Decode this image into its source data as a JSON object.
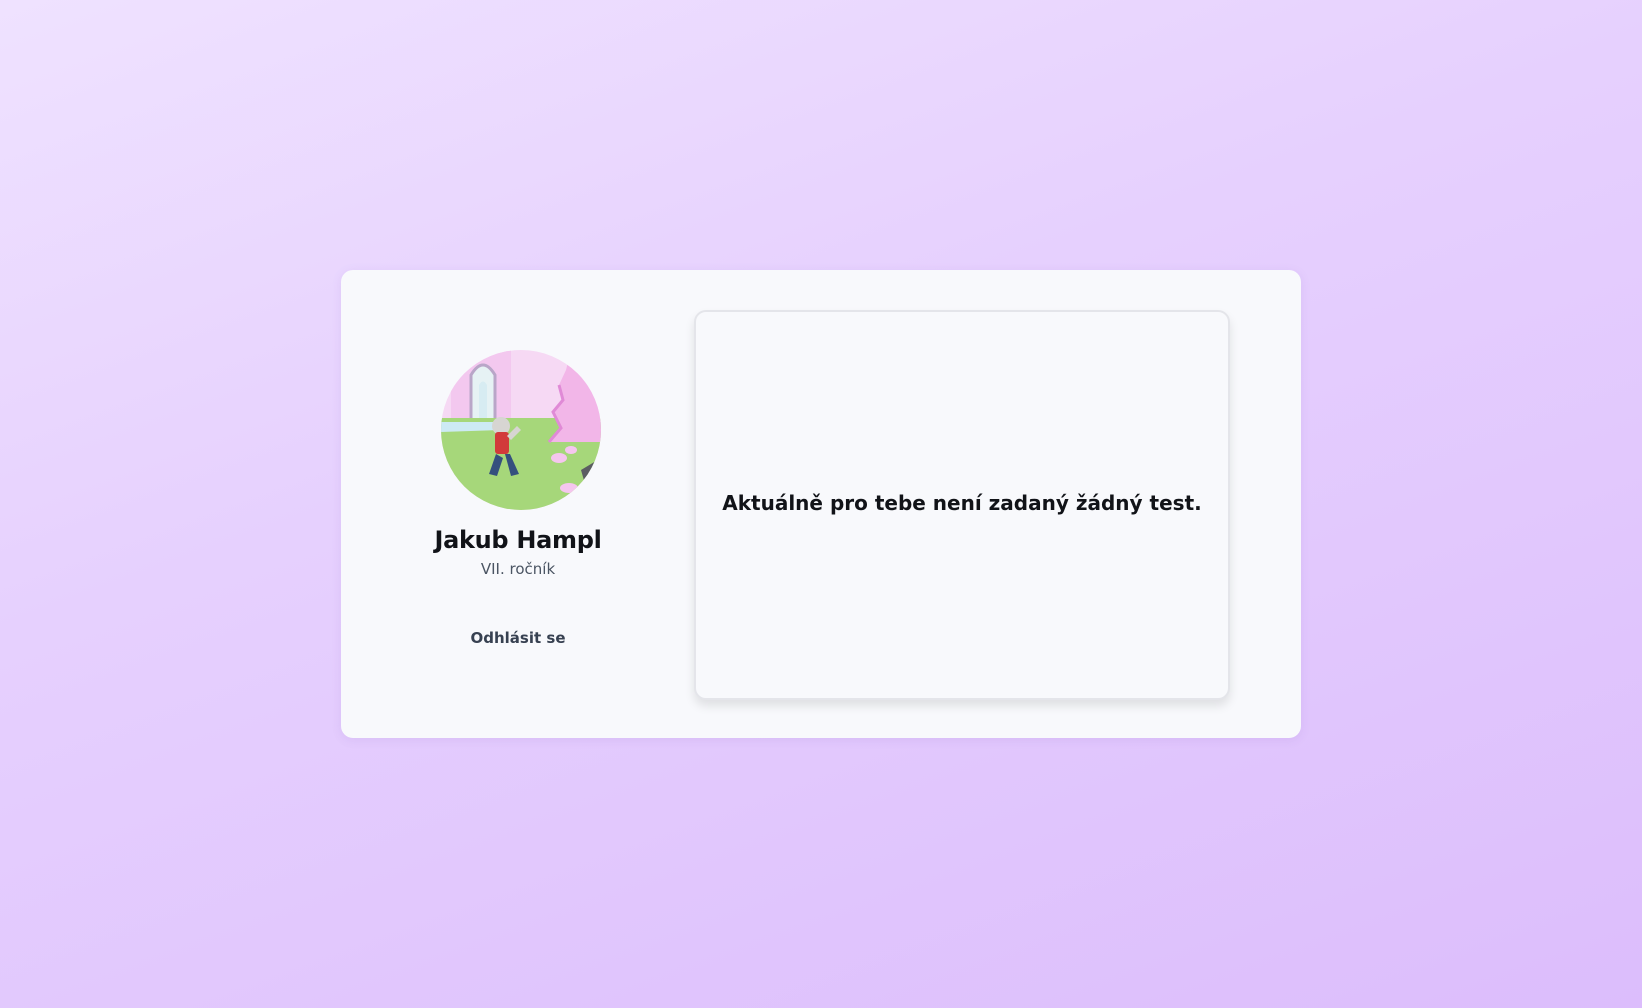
{
  "profile": {
    "avatar_description": "cartoon-avatar",
    "name": "Jakub Hampl",
    "grade": "VII. ročník",
    "logout_label": "Odhlásit se"
  },
  "tests": {
    "empty_message": "Aktuálně pro tebe není zadaný žádný test."
  },
  "colors": {
    "background_start": "#efe2ff",
    "background_end": "#dcbdfc",
    "card": "#f8f9fc",
    "text_primary": "#111318",
    "text_secondary": "#4b5563"
  }
}
